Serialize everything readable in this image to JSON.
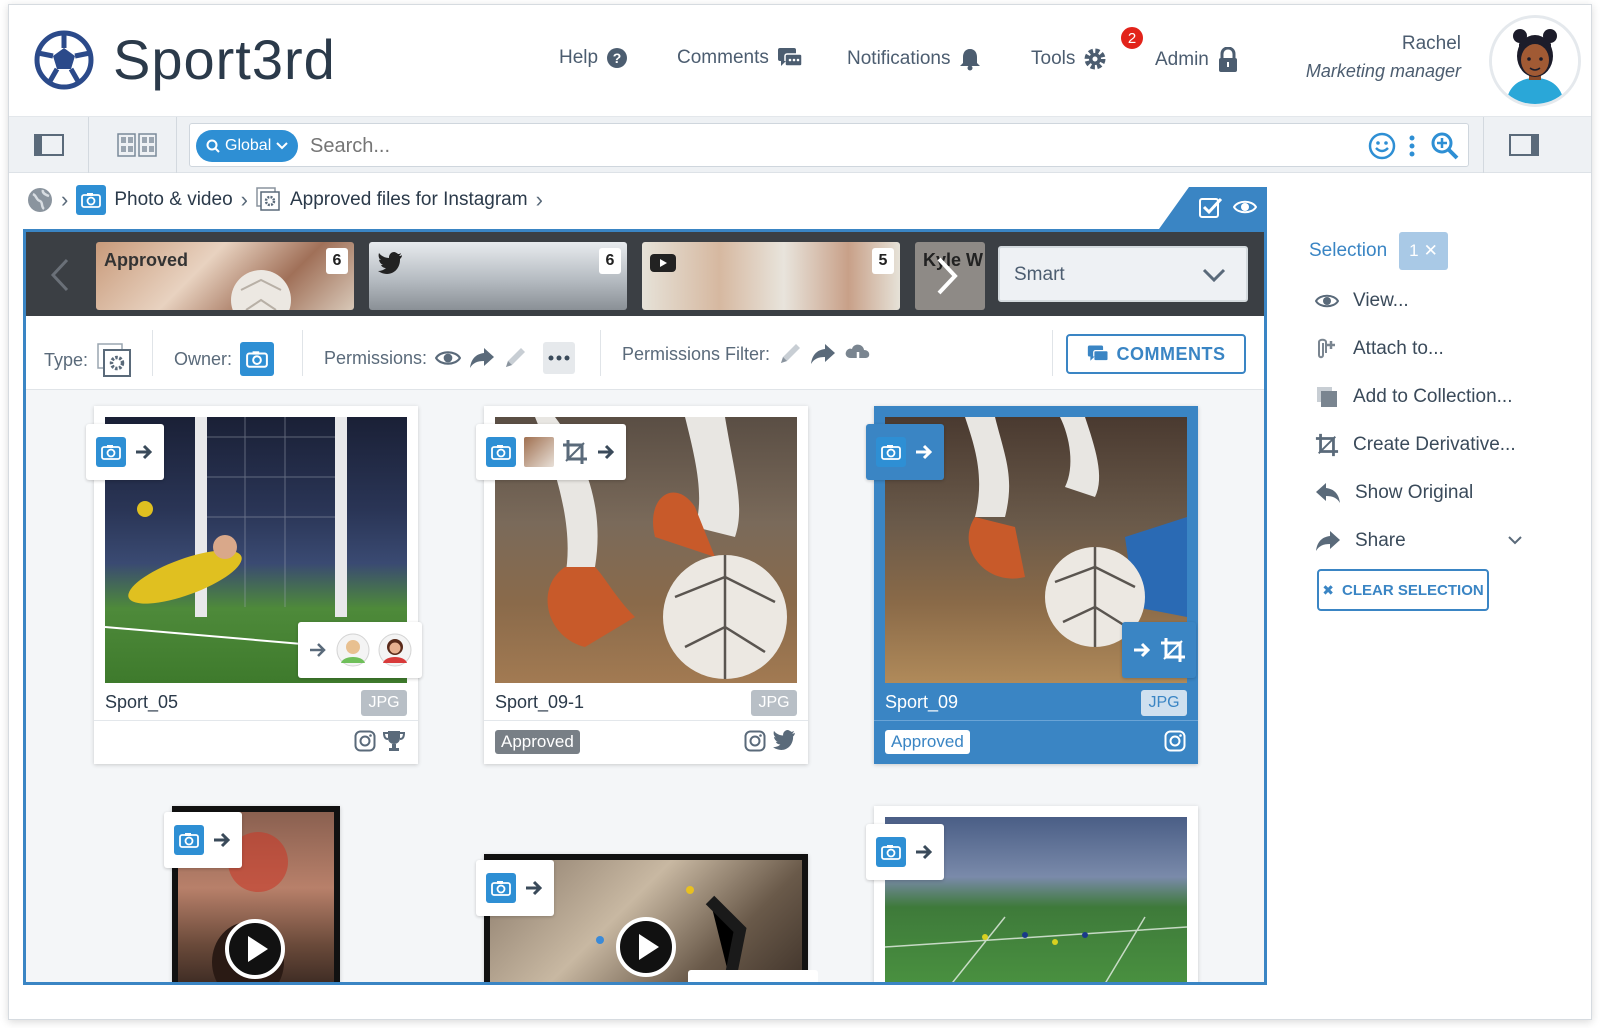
{
  "app": {
    "name": "Sport3rd"
  },
  "nav": {
    "help": "Help",
    "comments": "Comments",
    "notifications": "Notifications",
    "tools": "Tools",
    "tools_badge": "2",
    "admin": "Admin"
  },
  "user": {
    "name": "Rachel",
    "role": "Marketing manager"
  },
  "search": {
    "scope": "Global",
    "placeholder": "Search..."
  },
  "breadcrumb": {
    "section": "Photo & video",
    "collection": "Approved files for Instagram"
  },
  "strip": {
    "thumbs": [
      {
        "label": "Approved",
        "count": "6"
      },
      {
        "label": "",
        "count": "6",
        "icon": "twitter-icon"
      },
      {
        "label": "",
        "count": "5",
        "icon": "youtube-icon"
      },
      {
        "label": "Kyle W"
      }
    ],
    "sort": "Smart"
  },
  "filters": {
    "type": "Type:",
    "owner": "Owner:",
    "permissions": "Permissions:",
    "permissions_filter": "Permissions Filter:",
    "comments_button": "COMMENTS"
  },
  "cards": [
    {
      "name": "Sport_05",
      "format": "JPG",
      "status": ""
    },
    {
      "name": "Sport_09-1",
      "format": "JPG",
      "status": "Approved"
    },
    {
      "name": "Sport_09",
      "format": "JPG",
      "status": "Approved",
      "selected": true
    }
  ],
  "sidebar": {
    "title": "Selection",
    "count": "1",
    "actions": [
      "View...",
      "Attach to...",
      "Add to Collection...",
      "Create Derivative...",
      "Show Original",
      "Share"
    ],
    "clear": "CLEAR SELECTION"
  },
  "colors": {
    "accent": "#3a85c4",
    "brand": "#2e8fd4",
    "badge": "#e2231a"
  }
}
